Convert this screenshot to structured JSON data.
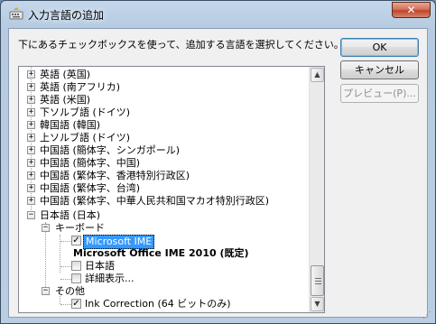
{
  "window": {
    "title": "入力言語の追加",
    "close_glyph": "✕"
  },
  "instruction": "下にあるチェックボックスを使って、追加する言語を選択してください。",
  "buttons": {
    "ok": "OK",
    "cancel": "キャンセル",
    "preview": "プレビュー(P)..."
  },
  "tree": {
    "languages": [
      "英語 (英国)",
      "英語 (南アフリカ)",
      "英語 (米国)",
      "下ソルブ語 (ドイツ)",
      "韓国語 (韓国)",
      "上ソルブ語 (ドイツ)",
      "中国語 (簡体字、シンガポール)",
      "中国語 (簡体字、中国)",
      "中国語 (繁体字、香港特別行政区)",
      "中国語 (繁体字、台湾)",
      "中国語 (繁体字、中華人民共和国マカオ特別行政区)"
    ],
    "japanese": {
      "label": "日本語 (日本)",
      "keyboard_group": "キーボード",
      "keyboards": [
        {
          "label": "Microsoft IME",
          "checked": true,
          "selected": true
        },
        {
          "label": "Microsoft Office IME 2010 (既定)",
          "bold": true
        },
        {
          "label": "日本語",
          "checked": false
        },
        {
          "label": "詳細表示...",
          "checked": false
        }
      ],
      "other_group": "その他",
      "other_items": [
        {
          "label": "Ink Correction (64 ビットのみ)",
          "checked": true
        }
      ]
    },
    "expander_plus": "+",
    "expander_minus": "−",
    "check_glyph": "✓"
  }
}
